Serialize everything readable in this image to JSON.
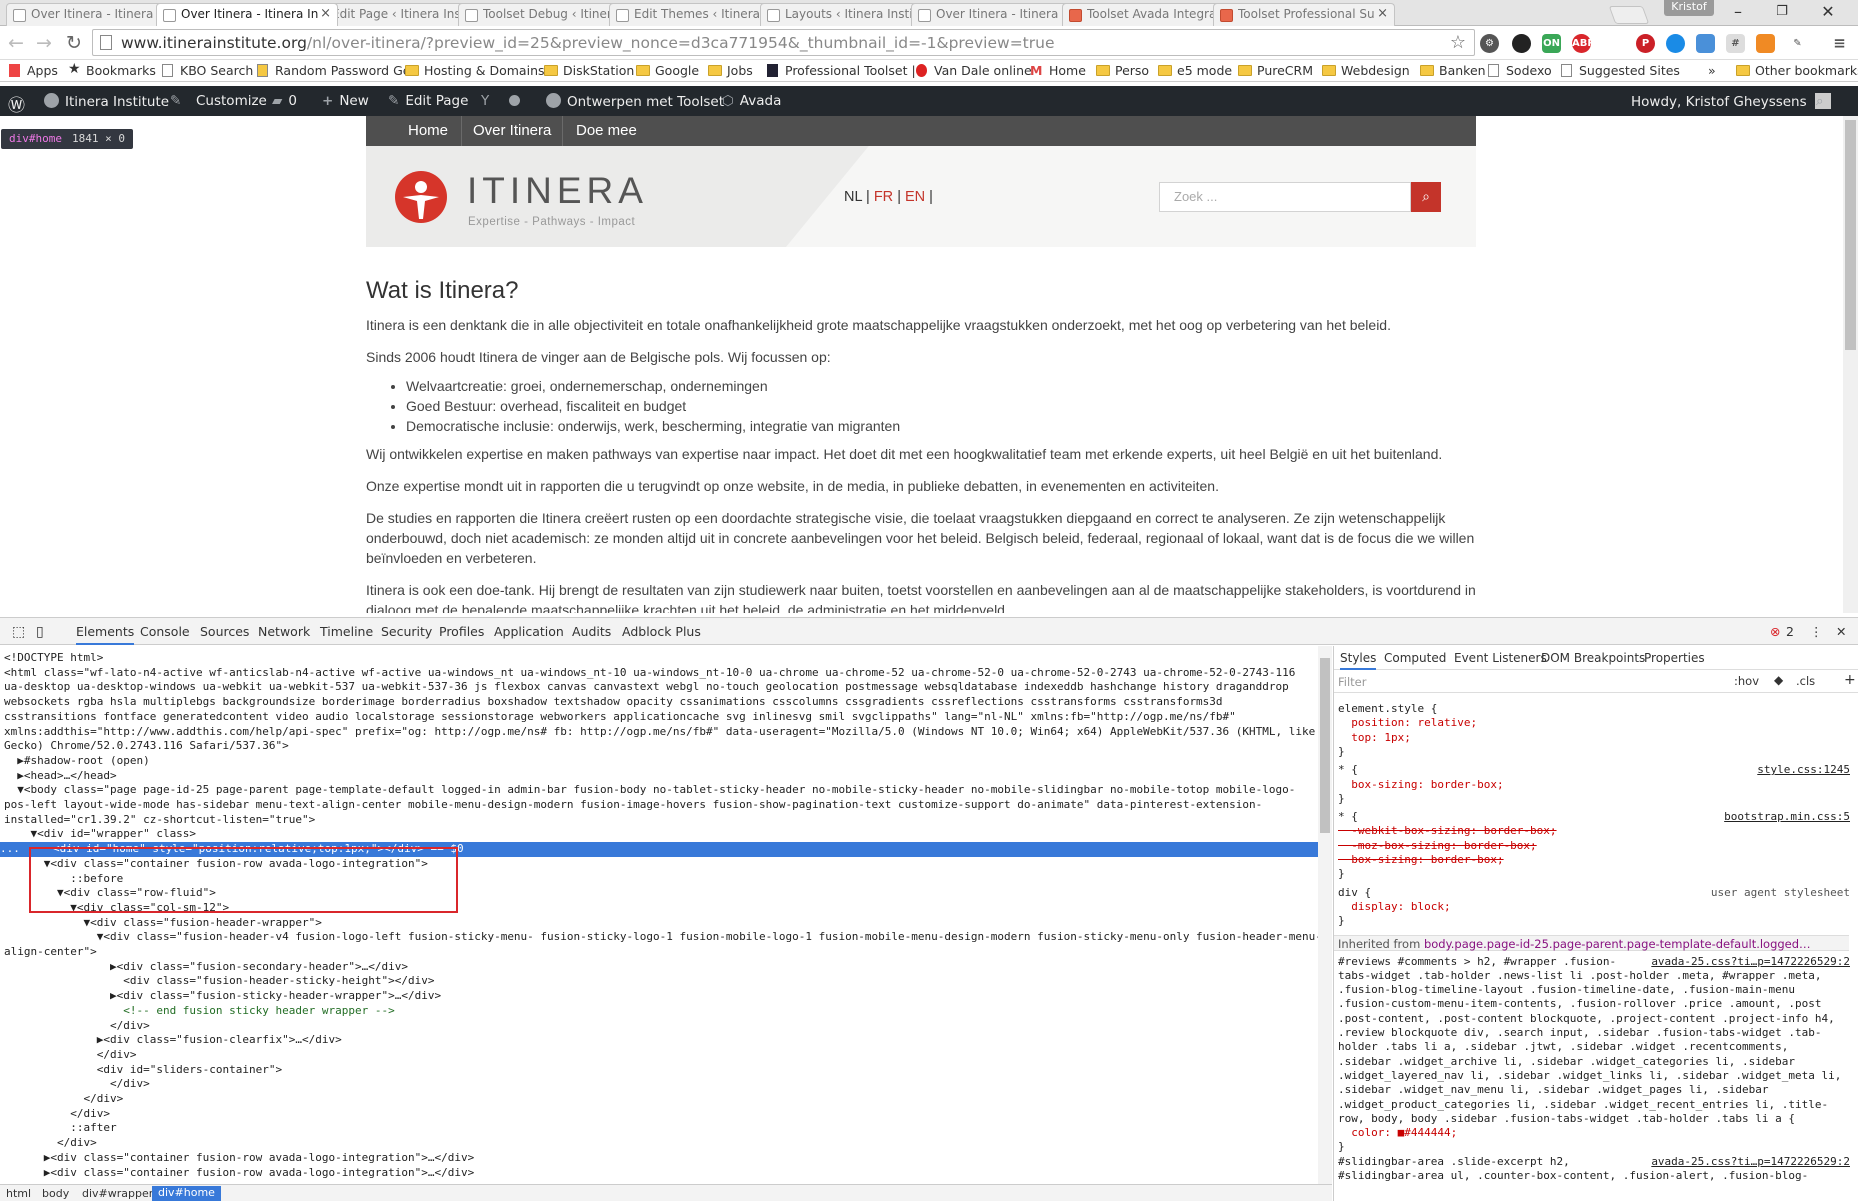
{
  "browser": {
    "tabs": [
      {
        "title": "Over Itinera - Itinera In",
        "active": false,
        "favicon": "page"
      },
      {
        "title": "Over Itinera - Itinera In",
        "active": true,
        "favicon": "page"
      },
      {
        "title": "Edit Page ‹ Itinera Insti",
        "active": false,
        "favicon": "page"
      },
      {
        "title": "Toolset Debug ‹ Itinera",
        "active": false,
        "favicon": "page"
      },
      {
        "title": "Edit Themes ‹ Itinera In",
        "active": false,
        "favicon": "page"
      },
      {
        "title": "Layouts ‹ Itinera Institu",
        "active": false,
        "favicon": "page"
      },
      {
        "title": "Over Itinera - Itinera In",
        "active": false,
        "favicon": "page"
      },
      {
        "title": "Toolset Avada Integrat",
        "active": false,
        "favicon": "toolset"
      },
      {
        "title": "Toolset Professional Su",
        "active": false,
        "favicon": "toolset"
      }
    ],
    "profile_name": "Kristof",
    "url_host": "www.itinerainstitute.org",
    "url_path": "/nl/over-itinera/?preview_id=25&preview_nonce=d3ca771954&_thumbnail_id=-1&preview=true",
    "bookmarks": [
      {
        "label": "Apps",
        "icon": "apps-grid-icon"
      },
      {
        "label": "Bookmarks",
        "icon": "star-icon"
      },
      {
        "label": "KBO Search",
        "icon": "page-icon"
      },
      {
        "label": "Random Password Ge",
        "icon": "key-icon"
      },
      {
        "label": "Hosting & Domains",
        "icon": "folder-icon"
      },
      {
        "label": "DiskStation",
        "icon": "folder-icon"
      },
      {
        "label": "Google",
        "icon": "folder-icon"
      },
      {
        "label": "Jobs",
        "icon": "folder-icon"
      },
      {
        "label": "Professional Toolset |",
        "icon": "page-icon"
      },
      {
        "label": "Van Dale online",
        "icon": "page-icon"
      },
      {
        "label": "Home",
        "icon": "gmail-icon"
      },
      {
        "label": "Perso",
        "icon": "folder-icon"
      },
      {
        "label": "e5 mode",
        "icon": "folder-icon"
      },
      {
        "label": "PureCRM",
        "icon": "folder-icon"
      },
      {
        "label": "Webdesign",
        "icon": "folder-icon"
      },
      {
        "label": "Banken",
        "icon": "folder-icon"
      },
      {
        "label": "Sodexo",
        "icon": "page-icon"
      },
      {
        "label": "Suggested Sites",
        "icon": "page-icon"
      }
    ],
    "bookmarks_overflow": "»",
    "other_bookmarks": "Other bookmarks"
  },
  "admin_bar": {
    "site_name": "Itinera Institute",
    "customize": "Customize",
    "comments": "0",
    "new": "New",
    "edit_page": "Edit Page",
    "toolset": "Ontwerpen met Toolset",
    "avada": "Avada",
    "howdy": "Howdy, Kristof Gheyssens"
  },
  "inspect_tooltip": {
    "tag": "div#home",
    "size": "1841 × 0"
  },
  "site": {
    "nav": [
      "Home",
      "Over Itinera",
      "Doe mee"
    ],
    "logo_text": "ITINERA",
    "logo_tagline": "Expertise - Pathways - Impact",
    "lang_nl": "NL",
    "lang_fr": "FR",
    "lang_en": "EN",
    "search_placeholder": "Zoek ...",
    "heading": "Wat is Itinera?",
    "p1": "Itinera is een denktank die in alle objectiviteit en totale onafhankelijkheid grote maatschappelijke vraagstukken onderzoekt, met het oog op verbetering van het beleid.",
    "p2": "Sinds 2006 houdt Itinera de vinger aan de Belgische pols. Wij focussen op:",
    "bullets": [
      "Welvaartcreatie: groei, ondernemerschap, ondernemingen",
      "Goed Bestuur: overhead, fiscaliteit en budget",
      "Democratische inclusie: onderwijs, werk, bescherming, integratie van migranten"
    ],
    "p3": "Wij ontwikkelen expertise en maken pathways van expertise naar impact. Het doet dit met een hoogkwalitatief team met erkende experts, uit heel België en uit het buitenland.",
    "p4": "Onze expertise mondt uit in rapporten die u terugvindt op onze website, in de media, in publieke debatten, in evenementen en activiteiten.",
    "p5": "De studies en rapporten die Itinera creëert rusten op een doordachte  strategische visie, die toelaat vraagstukken diepgaand en correct te analyseren. Ze zijn wetenschappelijk onderbouwd, doch niet academisch: ze monden altijd uit in concrete aanbevelingen voor het beleid. Belgisch beleid, federaal, regionaal of lokaal, want dat is de focus die we willen beïnvloeden en verbeteren.",
    "p6": "Itinera is ook een doe-tank. Hij brengt de resultaten van zijn studiewerk naar buiten, toetst voorstellen en aanbevelingen aan al de maatschappelijke stakeholders, is voortdurend in dialoog met de bepalende maatschappelijke krachten uit het beleid, de administratie en het middenveld."
  },
  "devtools": {
    "tabs": [
      "Elements",
      "Console",
      "Sources",
      "Network",
      "Timeline",
      "Security",
      "Profiles",
      "Application",
      "Audits",
      "Adblock Plus"
    ],
    "error_count": "2",
    "dom_lines": [
      "<!DOCTYPE html>",
      "<html class=\"wf-lato-n4-active wf-anticslab-n4-active wf-active ua-windows_nt ua-windows_nt-10 ua-windows_nt-10-0 ua-chrome ua-chrome-52 ua-chrome-52-0 ua-chrome-52-0-2743 ua-chrome-52-0-2743-116",
      "ua-desktop ua-desktop-windows ua-webkit ua-webkit-537 ua-webkit-537-36 js flexbox canvas canvastext webgl no-touch geolocation postmessage websqldatabase indexeddb hashchange history draganddrop",
      "websockets rgba hsla multiplebgs backgroundsize borderimage borderradius boxshadow textshadow opacity cssanimations csscolumns cssgradients cssreflections csstransforms csstransforms3d",
      "csstransitions fontface generatedcontent video audio localstorage sessionstorage webworkers applicationcache svg inlinesvg smil svgclippaths\" lang=\"nl-NL\" xmlns:fb=\"http://ogp.me/ns/fb#\"",
      "xmlns:addthis=\"http://www.addthis.com/help/api-spec\" prefix=\"og: http://ogp.me/ns# fb: http://ogp.me/ns/fb#\" data-useragent=\"Mozilla/5.0 (Windows NT 10.0; Win64; x64) AppleWebKit/537.36 (KHTML, like",
      "Gecko) Chrome/52.0.2743.116 Safari/537.36\">",
      "  ▶#shadow-root (open)",
      "  ▶<head>…</head>",
      "  ▼<body class=\"page page-id-25 page-parent page-template-default logged-in admin-bar fusion-body no-tablet-sticky-header no-mobile-sticky-header no-mobile-slidingbar no-mobile-totop mobile-logo-",
      "pos-left layout-wide-mode has-sidebar menu-text-align-center mobile-menu-design-modern fusion-image-hovers fusion-show-pagination-text customize-support do-animate\" data-pinterest-extension-",
      "installed=\"cr1.39.2\" cz-shortcut-listen=\"true\">",
      "    ▼<div id=\"wrapper\" class>",
      "...     <div id=\"home\" style=\"position:relative;top:1px;\"></div> == $0",
      "      ▼<div class=\"container fusion-row avada-logo-integration\">",
      "          ::before",
      "        ▼<div class=\"row-fluid\">",
      "          ▼<div class=\"col-sm-12\">",
      "            ▼<div class=\"fusion-header-wrapper\">",
      "              ▼<div class=\"fusion-header-v4 fusion-logo-left fusion-sticky-menu- fusion-sticky-logo-1 fusion-mobile-logo-1 fusion-mobile-menu-design-modern fusion-sticky-menu-only fusion-header-menu-",
      "align-center\">",
      "                ▶<div class=\"fusion-secondary-header\">…</div>",
      "                  <div class=\"fusion-header-sticky-height\"></div>",
      "                ▶<div class=\"fusion-sticky-header-wrapper\">…</div>",
      "                  <!-- end fusion sticky header wrapper -->",
      "                </div>",
      "              ▶<div class=\"fusion-clearfix\">…</div>",
      "              </div>",
      "              <div id=\"sliders-container\">",
      "                </div>",
      "            </div>",
      "          </div>",
      "          ::after",
      "        </div>",
      "      ▶<div class=\"container fusion-row avada-logo-integration\">…</div>",
      "      ▶<div class=\"container fusion-row avada-logo-integration\">…</div>"
    ],
    "breadcrumbs": [
      "html",
      "body",
      "div#wrapper",
      "div#home"
    ],
    "styles_tabs": [
      "Styles",
      "Computed",
      "Event Listeners",
      "DOM Breakpoints",
      "Properties"
    ],
    "filter_placeholder": "Filter",
    "filter_hov": ":hov",
    "filter_cls": ".cls",
    "style_lines": [
      "element.style {",
      "  position: relative;",
      "  top: 1px;",
      "}",
      "* {",
      "  box-sizing: border-box;",
      "}",
      "* {",
      "  -webkit-box-sizing: border-box;",
      "  -moz-box-sizing: border-box;",
      "  box-sizing: border-box;",
      "}",
      "div {",
      "  display: block;",
      "}"
    ],
    "style_sources": [
      "style.css:1245",
      "bootstrap.min.css:5",
      "user agent stylesheet"
    ],
    "inherited_label": "Inherited from",
    "inherited_selector": "body.page.page-id-25.page-parent.page-template-default.logged…",
    "inherited_source": "avada-25.css?ti…p=1472226529:2",
    "inherited_rule": [
      "#reviews #comments > h2, #wrapper .fusion-",
      "tabs-widget .tab-holder .news-list li .post-holder .meta, #wrapper .meta,",
      ".fusion-blog-timeline-layout .fusion-timeline-date, .fusion-main-menu",
      ".fusion-custom-menu-item-contents, .fusion-rollover .price .amount, .post",
      ".post-content, .post-content blockquote, .project-content .project-info h4,",
      ".review blockquote div, .search input, .sidebar .fusion-tabs-widget .tab-",
      "holder .tabs li a, .sidebar .jtwt, .sidebar .widget .recentcomments,",
      ".sidebar .widget_archive li, .sidebar .widget_categories li, .sidebar",
      ".widget_layered_nav li, .sidebar .widget_links li, .sidebar .widget_meta li,",
      ".sidebar .widget_nav_menu li, .sidebar .widget_pages li, .sidebar",
      ".widget_product_categories li, .sidebar .widget_recent_entries li, .title-",
      "row, body, body .sidebar .fusion-tabs-widget .tab-holder .tabs li a {",
      "  color: ■#444444;",
      "}",
      "#slidingbar-area .slide-excerpt h2,",
      "#slidingbar-area ul, .counter-box-content, .fusion-alert, .fusion-blog-"
    ]
  },
  "colors": {
    "brand_red": "#c4342a",
    "admin_bar": "#23282d",
    "site_nav": "#4f4f4f",
    "devtools_accent": "#3879d9"
  }
}
